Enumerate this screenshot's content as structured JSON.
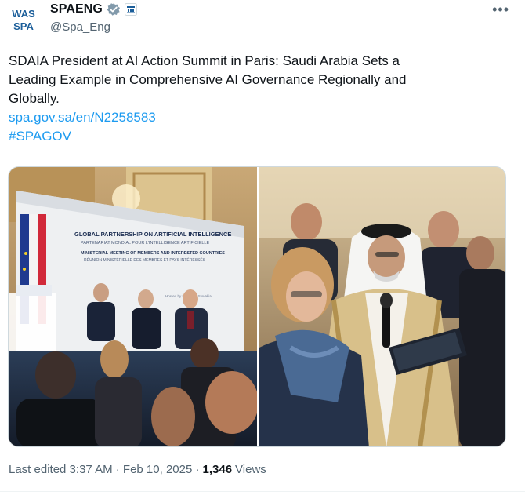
{
  "author": {
    "logo_text_top": "WAS",
    "logo_text_bottom": "SPA",
    "display_name": "SPAENG",
    "handle": "@Spa_Eng",
    "verified_icon": "verified-check-icon",
    "affiliation_icon": "government-badge-icon"
  },
  "menu": {
    "icon": "more-icon",
    "label": "•••"
  },
  "post": {
    "text_line1": "SDAIA President at AI Action Summit in Paris: Saudi Arabia Sets a",
    "text_line2": "Leading Example in Comprehensive AI Governance Regionally and",
    "text_line3": "Globally.",
    "link": "spa.gov.sa/en/N2258583",
    "hashtag": "#SPAGOV"
  },
  "media": {
    "banner_title": "GLOBAL PARTNERSHIP ON ARTIFICIAL INTELLIGENCE",
    "banner_subtitle": "PARTENARIAT MONDIAL POUR L'INTELLIGENCE ARTIFICIELLE",
    "banner_line3": "MINISTERIAL MEETING OF MEMBERS AND INTERESTED COUNTRIES",
    "banner_line4": "RÉUNION MINISTÉRIELLE DES MEMBRES ET PAYS INTÉRESSÉS",
    "banner_hosted": "Hosted by France ... Slovakia"
  },
  "footer": {
    "edited": "Last edited 3:37 AM · Feb 10, 2025 ·",
    "views_count": "1,346",
    "views_label": "Views"
  },
  "colors": {
    "link": "#1d9bf0",
    "text": "#0f1419",
    "muted": "#536471",
    "verified_badge": "#829aab",
    "logo_blue": "#1b5e9a"
  }
}
